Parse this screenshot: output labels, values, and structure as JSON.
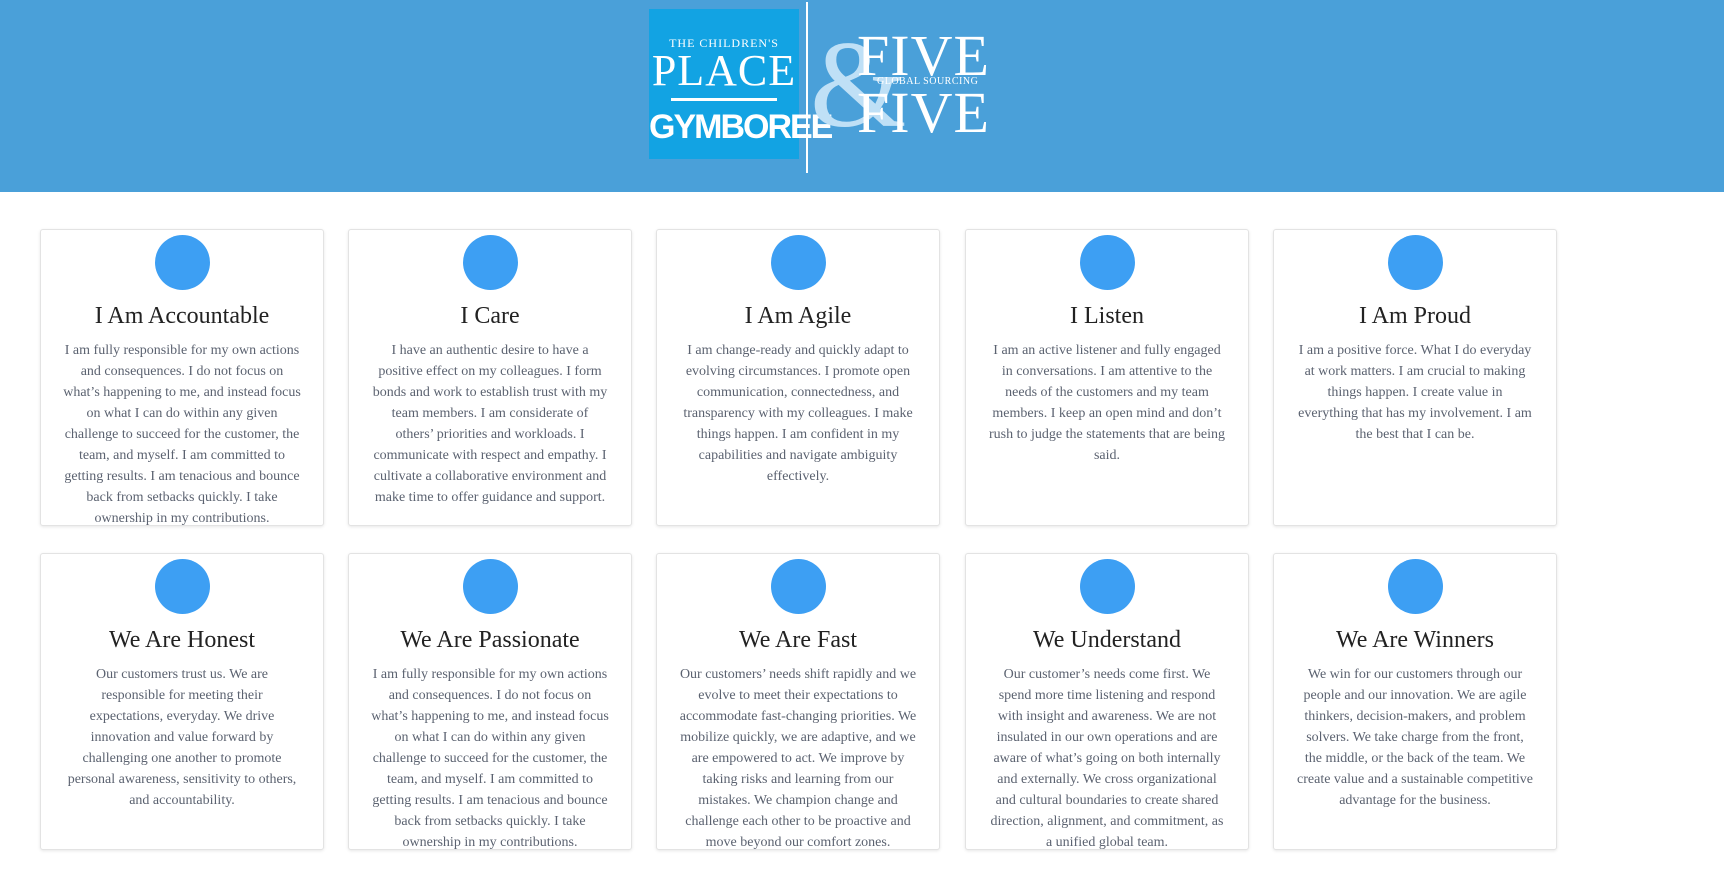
{
  "header": {
    "logo": {
      "top_text": "THE CHILDREN'S",
      "place": "PLACE",
      "gymboree": "GYMBOREE",
      "brand_bg": "#12a3e3"
    },
    "partner_logo": {
      "ampersand": "&",
      "five_top": "FIVE",
      "five_bottom": "FIVE",
      "sub": "GLOBAL SOURCING"
    },
    "bg_color": "#4aa0d9"
  },
  "accent_color": "#3d9ff3",
  "cards": [
    {
      "title": "I Am Accountable",
      "text": "I am fully responsible for my own actions and consequences. I do not focus on what’s happening to me, and instead focus on what I can do within any given challenge to succeed for the customer, the team, and myself. I am committed to getting results. I am tenacious and bounce back from setbacks quickly. I take ownership in my contributions."
    },
    {
      "title": "I Care",
      "text": "I have an authentic desire to have a positive effect on my colleagues. I form bonds and work to establish trust with my team members. I am considerate of others’ priorities and workloads. I communicate with respect and empathy. I cultivate a collaborative environment and make time to offer guidance and support."
    },
    {
      "title": "I Am Agile",
      "text": "I am change-ready and quickly adapt to evolving circumstances. I promote open communication, connectedness, and transparency with my colleagues. I make things happen. I am confident in my capabilities and navigate ambiguity effectively."
    },
    {
      "title": "I Listen",
      "text": "I am an active listener and fully engaged in conversations. I am attentive to the needs of the customers and my team members. I keep an open mind and don’t rush to judge the statements that are being said."
    },
    {
      "title": "I Am Proud",
      "text": "I am a positive force. What I do everyday at work matters. I am crucial to making things happen. I create value in everything that has my involvement. I am the best that I can be."
    },
    {
      "title": "We Are Honest",
      "text": "Our customers trust us. We are responsible for meeting their expectations, everyday. We drive innovation and value forward by challenging one another to promote personal awareness, sensitivity to others, and accountability."
    },
    {
      "title": "We Are Passionate",
      "text": "I am fully responsible for my own actions and consequences. I do not focus on what’s happening to me, and instead focus on what I can do within any given challenge to succeed for the customer, the team, and myself. I am committed to getting results. I am tenacious and bounce back from setbacks quickly. I take ownership in my contributions."
    },
    {
      "title": "We Are Fast",
      "text": "Our customers’ needs shift rapidly and we evolve to meet their expectations to accommodate fast-changing priorities. We mobilize quickly, we are adaptive, and we are empowered to act. We improve by taking risks and learning from our mistakes. We champion change and challenge each other to be proactive and move beyond our comfort zones."
    },
    {
      "title": "We Understand",
      "text": "Our customer’s needs come first. We spend more time listening and respond with insight and awareness. We are not insulated in our own operations and are aware of what’s going on both internally and externally. We cross organizational and cultural boundaries to create shared direction, alignment, and commitment, as a unified global team."
    },
    {
      "title": "We Are Winners",
      "text": "We win for our customers through our people and our innovation. We are agile thinkers, decision-makers, and problem solvers. We take charge from the front, the middle, or the back of the team. We create value and a sustainable competitive advantage for the business."
    }
  ]
}
